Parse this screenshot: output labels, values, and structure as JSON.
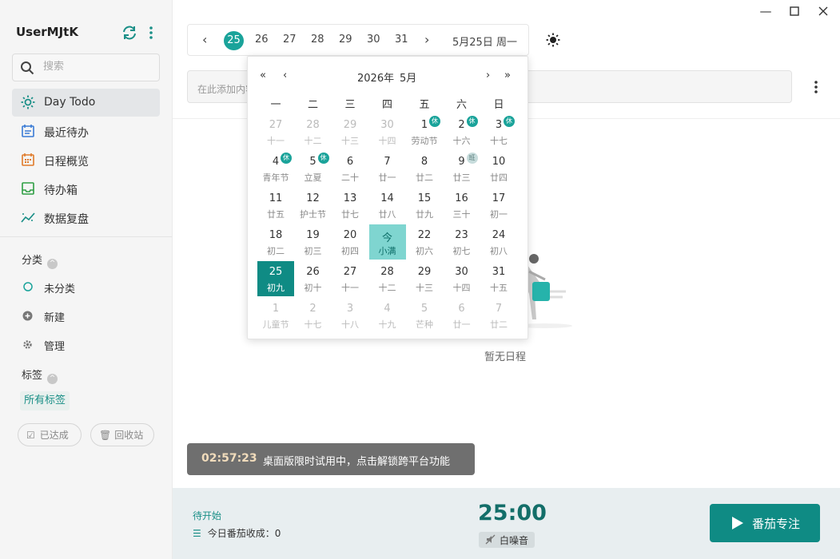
{
  "sidebar": {
    "username": "UserMJtK",
    "search_placeholder": "搜索",
    "nav": [
      "Day Todo",
      "最近待办",
      "日程概览",
      "待办箱",
      "数据复盘"
    ],
    "category_title": "分类",
    "categories": [
      "未分类",
      "新建",
      "管理"
    ],
    "tag_title": "标签",
    "all_tags": "所有标签",
    "done_label": "已达成",
    "trash_label": "回收站"
  },
  "datebar": {
    "days": [
      "25",
      "26",
      "27",
      "28",
      "29",
      "30",
      "31"
    ],
    "selected_day": "25",
    "current_label": "5月25日 周一"
  },
  "add_placeholder": "在此添加内容",
  "calendar": {
    "year_label": "2026年",
    "month_label": "5月",
    "weekdays": [
      "一",
      "二",
      "三",
      "四",
      "五",
      "六",
      "日"
    ],
    "cells": [
      {
        "d": "27",
        "l": "十一",
        "dim": true
      },
      {
        "d": "28",
        "l": "十二",
        "dim": true
      },
      {
        "d": "29",
        "l": "十三",
        "dim": true
      },
      {
        "d": "30",
        "l": "十四",
        "dim": true
      },
      {
        "d": "1",
        "l": "劳动节",
        "badge": "休"
      },
      {
        "d": "2",
        "l": "十六",
        "badge": "休"
      },
      {
        "d": "3",
        "l": "十七",
        "badge": "休"
      },
      {
        "d": "4",
        "l": "青年节",
        "badge": "休"
      },
      {
        "d": "5",
        "l": "立夏",
        "badge": "休"
      },
      {
        "d": "6",
        "l": "二十"
      },
      {
        "d": "7",
        "l": "廿一"
      },
      {
        "d": "8",
        "l": "廿二"
      },
      {
        "d": "9",
        "l": "廿三",
        "badge": "班"
      },
      {
        "d": "10",
        "l": "廿四"
      },
      {
        "d": "11",
        "l": "廿五"
      },
      {
        "d": "12",
        "l": "护士节"
      },
      {
        "d": "13",
        "l": "廿七"
      },
      {
        "d": "14",
        "l": "廿八"
      },
      {
        "d": "15",
        "l": "廿九"
      },
      {
        "d": "16",
        "l": "三十"
      },
      {
        "d": "17",
        "l": "初一"
      },
      {
        "d": "18",
        "l": "初二"
      },
      {
        "d": "19",
        "l": "初三"
      },
      {
        "d": "20",
        "l": "初四"
      },
      {
        "d": "今",
        "l": "小满",
        "today": true
      },
      {
        "d": "22",
        "l": "初六"
      },
      {
        "d": "23",
        "l": "初七"
      },
      {
        "d": "24",
        "l": "初八"
      },
      {
        "d": "25",
        "l": "初九",
        "selected": true
      },
      {
        "d": "26",
        "l": "初十"
      },
      {
        "d": "27",
        "l": "十一"
      },
      {
        "d": "28",
        "l": "十二"
      },
      {
        "d": "29",
        "l": "十三"
      },
      {
        "d": "30",
        "l": "十四"
      },
      {
        "d": "31",
        "l": "十五"
      },
      {
        "d": "1",
        "l": "儿童节",
        "dim": true
      },
      {
        "d": "2",
        "l": "十七",
        "dim": true
      },
      {
        "d": "3",
        "l": "十八",
        "dim": true
      },
      {
        "d": "4",
        "l": "十九",
        "dim": true
      },
      {
        "d": "5",
        "l": "芒种",
        "dim": true
      },
      {
        "d": "6",
        "l": "廿一",
        "dim": true
      },
      {
        "d": "7",
        "l": "廿二",
        "dim": true
      }
    ]
  },
  "empty_label": "暂无日程",
  "trial": {
    "time": "02:57:23",
    "message": "桌面版限时试用中，点击解锁跨平台功能"
  },
  "footer": {
    "status": "待开始",
    "count_label": "今日番茄收成：0",
    "timer": "25:00",
    "noise_label": "白噪音",
    "start_label": "番茄专注"
  },
  "colors": {
    "accent": "#1aa39a",
    "accent_dark": "#0f8b84",
    "today_bg": "#7fd5d0"
  }
}
